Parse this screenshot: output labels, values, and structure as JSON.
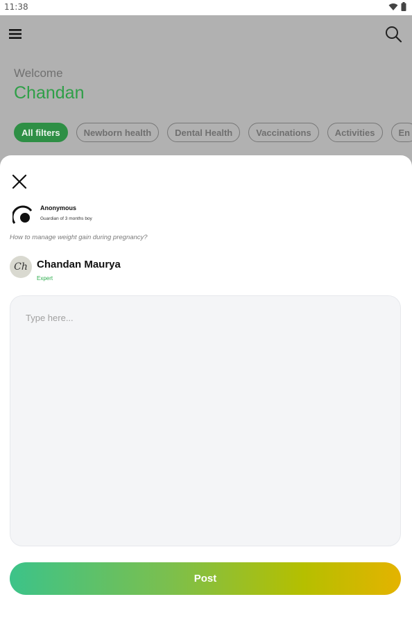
{
  "status_bar": {
    "time": "11:38"
  },
  "header": {
    "welcome_label": "Welcome",
    "user_name": "Chandan"
  },
  "filters": [
    "All filters",
    "Newborn health",
    "Dental Health",
    "Vaccinations",
    "Activities",
    "En"
  ],
  "sheet": {
    "asker": {
      "name": "Anonymous",
      "subtitle": "Guardian of 3 months boy"
    },
    "question": "How to manage weight gain during pregnancy?",
    "expert": {
      "avatar_initials": "Ch",
      "name": "Chandan Maurya",
      "tag": "Expert"
    },
    "answer_placeholder": "Type here...",
    "post_label": "Post"
  },
  "colors": {
    "brand_green": "#2e8f45",
    "expert_green": "#2fae4f"
  }
}
